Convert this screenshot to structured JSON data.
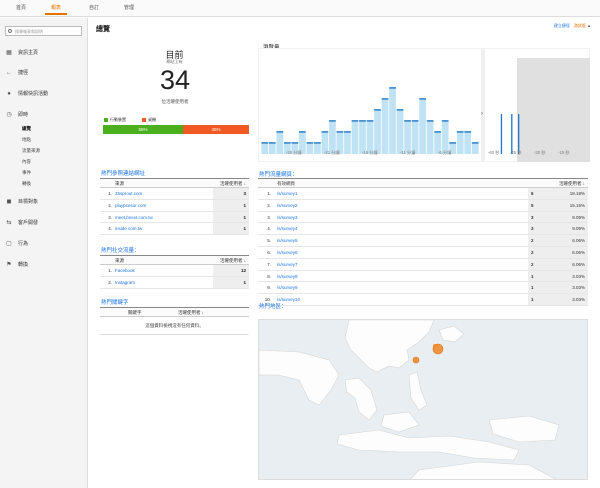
{
  "topnav": {
    "tabs": [
      {
        "label": "首頁"
      },
      {
        "label": "報表"
      },
      {
        "label": "自訂"
      },
      {
        "label": "管理"
      }
    ]
  },
  "sidebar": {
    "search_placeholder": "搜尋報表和說明",
    "items": [
      {
        "label": "資訊主頁",
        "icon": "grid-icon"
      },
      {
        "label": "捷徑",
        "icon": "shortcut-icon"
      },
      {
        "label": "情報快訊活動",
        "icon": "lightbulb-icon"
      },
      {
        "label": "即時",
        "icon": "clock-icon"
      },
      {
        "label": "目標對象",
        "icon": "person-icon"
      },
      {
        "label": "客戶開發",
        "icon": "acquisition-icon"
      },
      {
        "label": "行為",
        "icon": "behavior-icon"
      },
      {
        "label": "轉換",
        "icon": "flag-icon"
      }
    ],
    "subitems": [
      {
        "label": "總覽",
        "active": true
      },
      {
        "label": "地點"
      },
      {
        "label": "流量來源"
      },
      {
        "label": "內容"
      },
      {
        "label": "事件"
      },
      {
        "label": "轉換"
      }
    ]
  },
  "main": {
    "title": "總覽",
    "links": {
      "create": "建立捷徑",
      "beta": "測試版"
    },
    "realtime": {
      "label": "目前",
      "sublabel": "網站上有",
      "count": "34",
      "caption": "位活躍使用者",
      "legend": [
        {
          "label": "行動裝置",
          "color": "#4caf1e"
        },
        {
          "label": "桌機",
          "color": "#f15a24"
        }
      ],
      "segments": [
        {
          "percent": 55,
          "label": "55%",
          "color": "#4caf1e"
        },
        {
          "percent": 45,
          "label": "45%",
          "color": "#f15a24"
        }
      ]
    },
    "pageviews": {
      "title": "瀏覽量",
      "left_unit": "每分鐘",
      "right_unit": "每秒",
      "x_labels": [
        "-26 分鐘",
        "-21 分鐘",
        "-16 分鐘",
        "-11 分鐘",
        "-6 分鐘"
      ],
      "right_x_labels": [
        "-60 秒",
        "-45 秒",
        "-30 秒",
        "-15 秒"
      ],
      "per_minute": [
        1,
        1,
        2,
        1,
        1,
        2,
        1,
        1,
        2,
        3,
        2,
        2,
        3,
        3,
        3,
        4,
        5,
        6,
        4,
        3,
        3,
        5,
        3,
        2,
        3,
        1,
        2,
        2,
        1
      ],
      "per_second": [
        0,
        0,
        0,
        0,
        1,
        0,
        0,
        1,
        0,
        1,
        0,
        0,
        0,
        0,
        0,
        0,
        0,
        0,
        0,
        0,
        0,
        0,
        0,
        0,
        0,
        0,
        0,
        0,
        0
      ]
    },
    "top_referrals": {
      "title": "熱門參照連結網址",
      "headers": {
        "source": "來源",
        "users": "活躍使用者"
      },
      "rows": [
        {
          "num": "1.",
          "source": "25sprout.com",
          "users": "3"
        },
        {
          "num": "2.",
          "source": "playpcesor.com",
          "users": "1"
        },
        {
          "num": "3.",
          "source": "meet.bnext.com.tw",
          "users": "1"
        },
        {
          "num": "4.",
          "source": "inside.com.tw",
          "users": "1"
        }
      ]
    },
    "top_social": {
      "title": "熱門社交流量：",
      "headers": {
        "source": "來源",
        "users": "活躍使用者"
      },
      "rows": [
        {
          "num": "1.",
          "source": "Facebook",
          "users": "12"
        },
        {
          "num": "2.",
          "source": "Instagram",
          "users": "1"
        }
      ]
    },
    "top_keywords": {
      "title": "熱門關鍵字",
      "headers": {
        "keyword": "關鍵字",
        "users": "活躍使用者"
      },
      "empty": "這個資料檢視沒有任何資料。"
    },
    "top_pages": {
      "title": "熱門流量網頁：",
      "headers": {
        "page": "有效網頁",
        "users": "活躍使用者"
      },
      "rows": [
        {
          "num": "1.",
          "page": "/s/survey1",
          "users": "6",
          "pct": "18.18%"
        },
        {
          "num": "2.",
          "page": "/s/survey2",
          "users": "5",
          "pct": "15.15%"
        },
        {
          "num": "3.",
          "page": "/s/survey3",
          "users": "3",
          "pct": "9.09%"
        },
        {
          "num": "4.",
          "page": "/s/survey4",
          "users": "3",
          "pct": "9.09%"
        },
        {
          "num": "5.",
          "page": "/s/survey5",
          "users": "2",
          "pct": "6.06%"
        },
        {
          "num": "6.",
          "page": "/s/survey6",
          "users": "2",
          "pct": "6.06%"
        },
        {
          "num": "7.",
          "page": "/s/survey7",
          "users": "2",
          "pct": "6.06%"
        },
        {
          "num": "8.",
          "page": "/s/survey8",
          "users": "1",
          "pct": "3.03%"
        },
        {
          "num": "9.",
          "page": "/s/survey9",
          "users": "1",
          "pct": "3.03%"
        },
        {
          "num": "10.",
          "page": "/s/survey10",
          "users": "1",
          "pct": "3.03%"
        }
      ]
    },
    "top_locations": {
      "title": "熱門地區："
    }
  }
}
